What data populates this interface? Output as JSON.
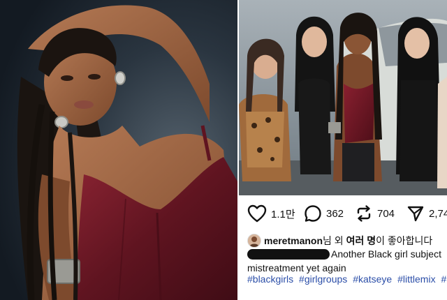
{
  "post": {
    "actions": {
      "likes_count": "1.1만",
      "comments_count": "362",
      "reposts_count": "704",
      "shares_count": "2,74"
    },
    "liked_by": {
      "username": "meretmanon",
      "suffix": "님 외 ",
      "bold_count": "여러 명",
      "tail": "이 좋아합니다"
    },
    "caption": {
      "line1": "Another Black girl subject",
      "line2": "mistreatment yet again"
    },
    "hashtags": [
      "#blackgirls",
      "#girlgroups",
      "#katseye",
      "#littlemix",
      "#"
    ]
  },
  "colors": {
    "text": "#111111",
    "hashtag": "#2b4ea8",
    "dress": "#6e1a26"
  },
  "icons": {
    "like": "heart-icon",
    "comment": "comment-bubble-icon",
    "repost": "repost-arrows-icon",
    "share": "paper-plane-icon"
  }
}
